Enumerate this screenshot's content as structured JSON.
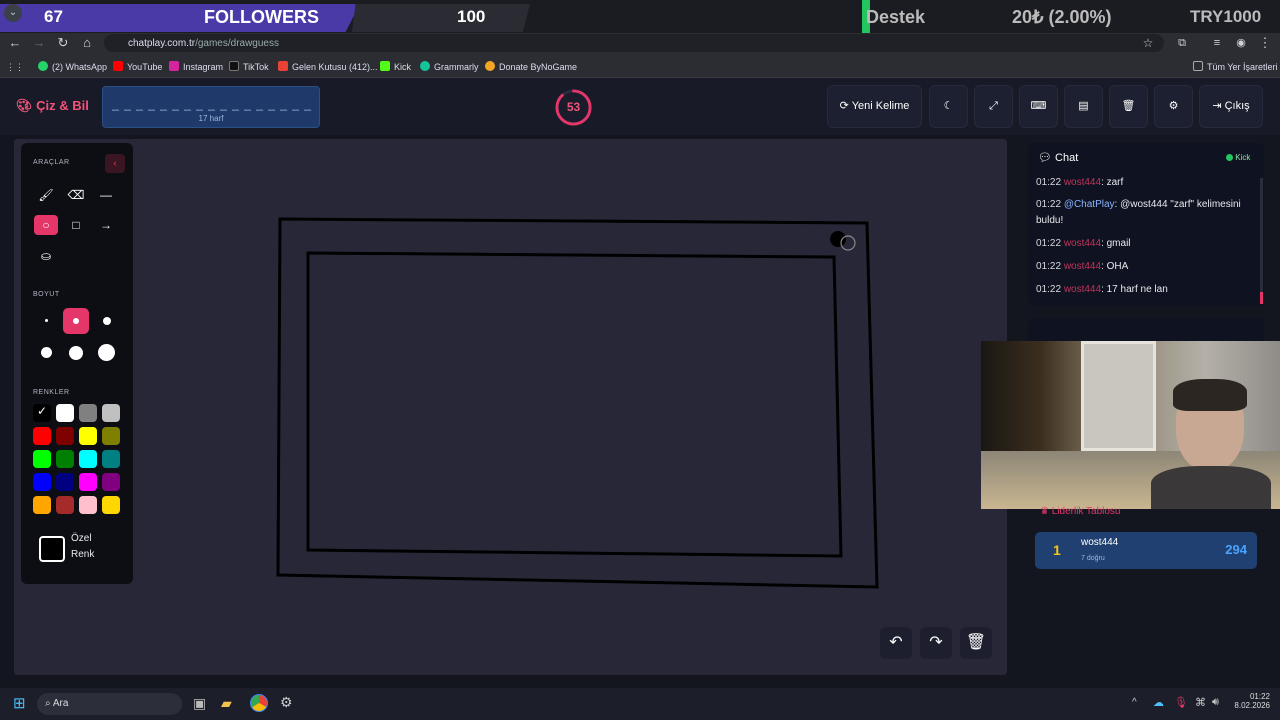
{
  "overlay": {
    "followers_count": "67",
    "followers_label": "FOLLOWERS",
    "followers_target": "100",
    "support_label": "Destek",
    "support_amount": "20₺ (2.00%)",
    "support_goal": "TRY1000"
  },
  "browser": {
    "url_domain": "chatplay.com.tr",
    "url_path": "/games/drawguess",
    "bookmarks": [
      "(2) WhatsApp",
      "YouTube",
      "Instagram",
      "TikTok",
      "Gelen Kutusu (412)...",
      "Kick",
      "Grammarly",
      "Donate ByNoGame"
    ],
    "all_bookmarks": "Tüm Yer İşaretleri"
  },
  "app": {
    "logo": "Çiz & Bil",
    "word_dashes": "_ _ _ _ _ _ _ _ _ _ _ _ _ _ _ _ _",
    "word_hint": "17 harf",
    "timer": "53",
    "timer_fraction": 0.88,
    "new_word_label": "Yeni Kelime",
    "exit_label": "Çıkış"
  },
  "tools": {
    "tools_title": "ARAÇLAR",
    "size_title": "BOYUT",
    "colors_title": "RENKLER",
    "custom_color_label_1": "Özel",
    "custom_color_label_2": "Renk",
    "colors": [
      "#000000",
      "#ffffff",
      "#808080",
      "#c0c0c0",
      "#ff0000",
      "#800000",
      "#ffff00",
      "#808000",
      "#00ff00",
      "#008000",
      "#00ffff",
      "#008080",
      "#0000ff",
      "#000080",
      "#ff00ff",
      "#800080",
      "#ffa500",
      "#a52a2a",
      "#ffc0cb",
      "#ffd700"
    ]
  },
  "chat": {
    "title": "Chat",
    "platform": "Kick",
    "messages": [
      {
        "time": "01:22",
        "user": "wost444",
        "text": ": zarf",
        "system": false
      },
      {
        "time": "01:22",
        "user": "@ChatPlay",
        "text": ": @wost444 \"zarf\" kelimesini buldu!",
        "system": true
      },
      {
        "time": "01:22",
        "user": "wost444",
        "text": ": gmail",
        "system": false
      },
      {
        "time": "01:22",
        "user": "wost444",
        "text": ": OHA",
        "system": false
      },
      {
        "time": "01:22",
        "user": "wost444",
        "text": ": 17 harf ne lan",
        "system": false
      }
    ]
  },
  "leaderboard": {
    "title": "Liderlik Tablosu",
    "rows": [
      {
        "rank": "1",
        "name": "wost444",
        "sub": "7 doğru",
        "score": "294"
      }
    ]
  },
  "taskbar": {
    "search": "Ara",
    "time": "01:22",
    "date": "8.02.2026"
  }
}
